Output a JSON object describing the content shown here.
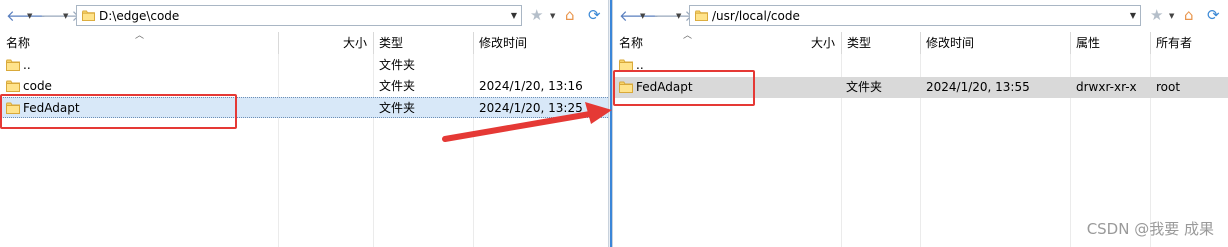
{
  "left_pane": {
    "address": "D:\\edge\\code",
    "columns": {
      "name": "名称",
      "size": "大小",
      "type": "类型",
      "modified": "修改时间"
    },
    "rows": [
      {
        "name": "..",
        "size": "",
        "type": "文件夹",
        "modified": ""
      },
      {
        "name": "code",
        "size": "",
        "type": "文件夹",
        "modified": "2024/1/20, 13:16"
      },
      {
        "name": "FedAdapt",
        "size": "",
        "type": "文件夹",
        "modified": "2024/1/20, 13:25"
      }
    ]
  },
  "right_pane": {
    "address": "/usr/local/code",
    "columns": {
      "name": "名称",
      "size": "大小",
      "type": "类型",
      "modified": "修改时间",
      "attributes": "属性",
      "owner": "所有者"
    },
    "rows": [
      {
        "name": "..",
        "size": "",
        "type": "",
        "modified": "",
        "attributes": "",
        "owner": ""
      },
      {
        "name": "FedAdapt",
        "size": "",
        "type": "文件夹",
        "modified": "2024/1/20, 13:55",
        "attributes": "drwxr-xr-x",
        "owner": "root"
      }
    ]
  },
  "icons": {
    "back": "back-arrow-icon",
    "forward": "forward-arrow-icon",
    "folder": "folder-icon",
    "dropdown": "chevron-down-icon",
    "bookmark": "star-icon",
    "home": "home-icon",
    "refresh": "refresh-icon"
  },
  "annotation": {
    "highlight_color": "#e53935",
    "arrow_color": "#e53935"
  },
  "watermark": "CSDN @我要 成果"
}
